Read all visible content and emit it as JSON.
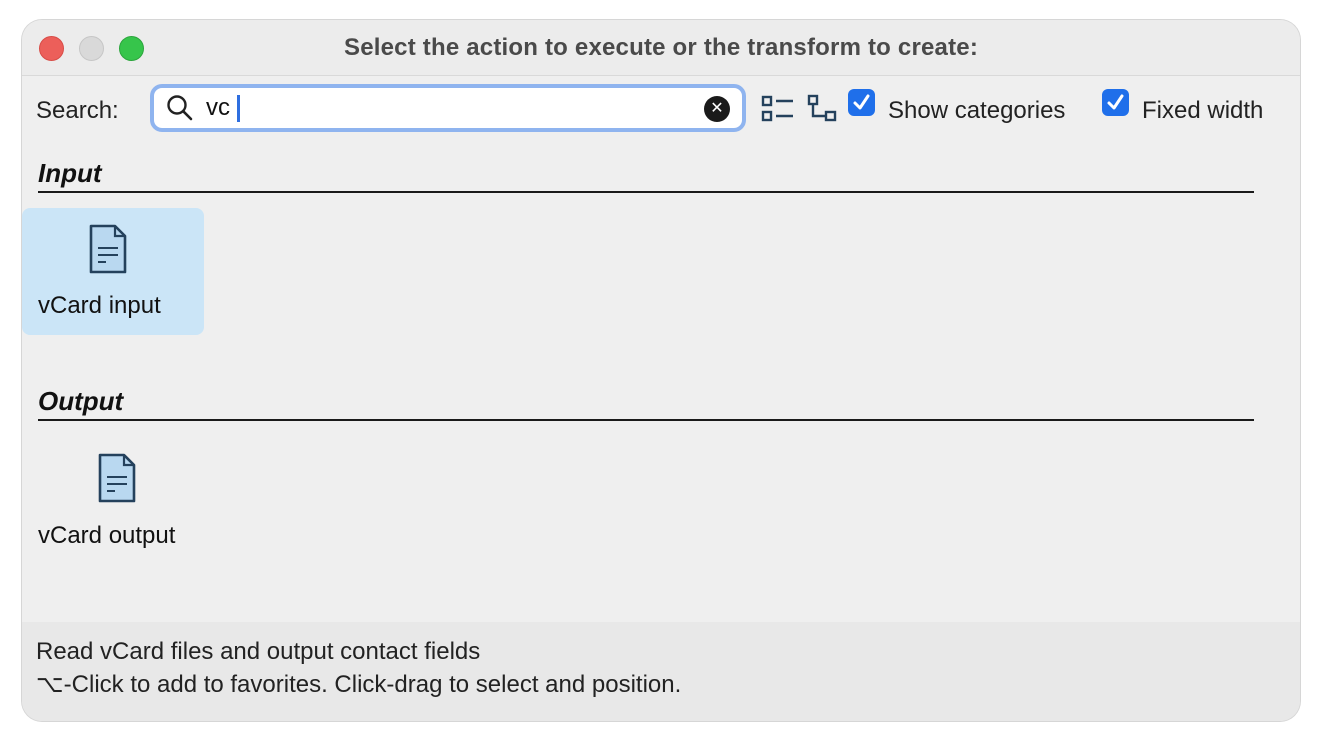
{
  "window": {
    "title": "Select the action to execute or the transform to create:"
  },
  "toolbar": {
    "search_label": "Search:",
    "search_value": "vc",
    "clear_icon": "x-circle-icon",
    "show_categories_label": "Show categories",
    "show_categories_checked": true,
    "fixed_width_label": "Fixed width",
    "fixed_width_checked": true
  },
  "sections": [
    {
      "title": "Input",
      "items": [
        {
          "label": "vCard input",
          "icon": "document-icon",
          "selected": true
        }
      ]
    },
    {
      "title": "Output",
      "items": [
        {
          "label": "vCard output",
          "icon": "document-icon",
          "selected": false
        }
      ]
    }
  ],
  "status": {
    "description": "Read vCard files and output contact fields",
    "hint": "⌥-Click to add to favorites. Click-drag to select and position."
  },
  "colors": {
    "accent": "#1f6fea",
    "selection": "#cbe5f7",
    "close": "#ec5f5a",
    "maximize": "#36c54b"
  }
}
